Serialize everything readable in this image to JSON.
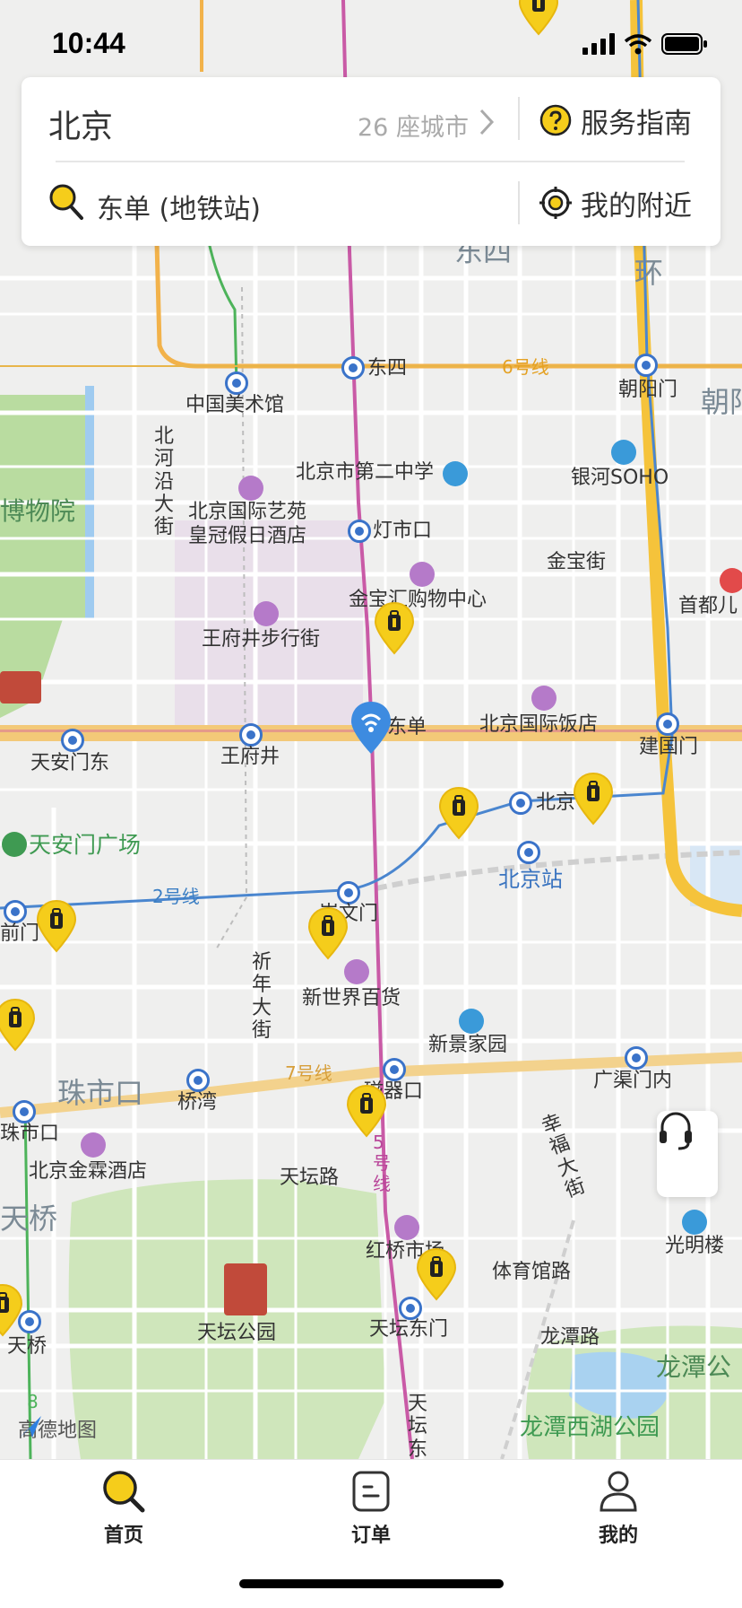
{
  "status_bar": {
    "time": "10:44"
  },
  "search_card": {
    "city": "北京",
    "city_count": "26 座城市",
    "guide_label": "服务指南",
    "search_text": "东单 (地铁站)",
    "nearby_label": "我的附近"
  },
  "map": {
    "watermark": "高德地图",
    "labels": {
      "l_dongsi_area": "东四",
      "l_huan": "环",
      "l_chaoyang_big": "朝阳",
      "l_dongsi": "东四",
      "l_line6": "6号线",
      "l_chaoyangmen": "朝阳门",
      "l_meishuguan": "中国美术馆",
      "l_beiheyan": "北河沿大街",
      "l_no2school": "北京市第二中学",
      "l_yinhe": "银河SOHO",
      "l_museum": "博物院",
      "l_guoyi1": "北京国际艺苑",
      "l_guoyi2": "皇冠假日酒店",
      "l_dengshikou": "灯市口",
      "l_jinbao": "金宝街",
      "l_shoudu": "首都儿",
      "l_jinbaohui": "金宝汇购物中心",
      "l_wangfujing_st": "王府井步行街",
      "l_dongdan": "东单",
      "l_guoji_hotel": "北京国际饭店",
      "l_jianguomen": "建国门",
      "l_tiananmen_e": "天安门东",
      "l_wangfujing": "王府井",
      "l_beijing_short": "北京",
      "l_tiananmen_sq": "天安门广场",
      "l_beijingzhan": "北京站",
      "l_line2": "2号线",
      "l_qianmen": "前门",
      "l_chongwenmen": "崇文门",
      "l_qinian": "祈年大街",
      "l_newworld": "新世界百货",
      "l_xinjing": "新景家园",
      "l_line7": "7号线",
      "l_zhushikou_big": "珠市口",
      "l_qiaowan": "桥湾",
      "l_ciqikou": "磁器口",
      "l_guangqumen": "广渠门内",
      "l_zhushikou": "珠市口",
      "l_jinlin": "北京金霖酒店",
      "l_xingfu": "幸福大街",
      "l_tiantan_rd": "天坛路",
      "l_line5": "5号线",
      "l_tianqiao_big": "天桥",
      "l_hongqiao": "红桥市场",
      "l_tiyuguan": "体育馆路",
      "l_guangming": "光明楼",
      "l_tiantan_park": "天坛公园",
      "l_tiantan_e": "天坛东门",
      "l_longtan_rd": "龙潭路",
      "l_longtan_big": "龙潭公",
      "l_tianqiao": "天桥",
      "l_longtan_park": "龙潭西湖公园",
      "l_tiantan_bottom": "天坛东",
      "l_line8": "8"
    }
  },
  "tabbar": {
    "home": "首页",
    "orders": "订单",
    "mine": "我的"
  }
}
